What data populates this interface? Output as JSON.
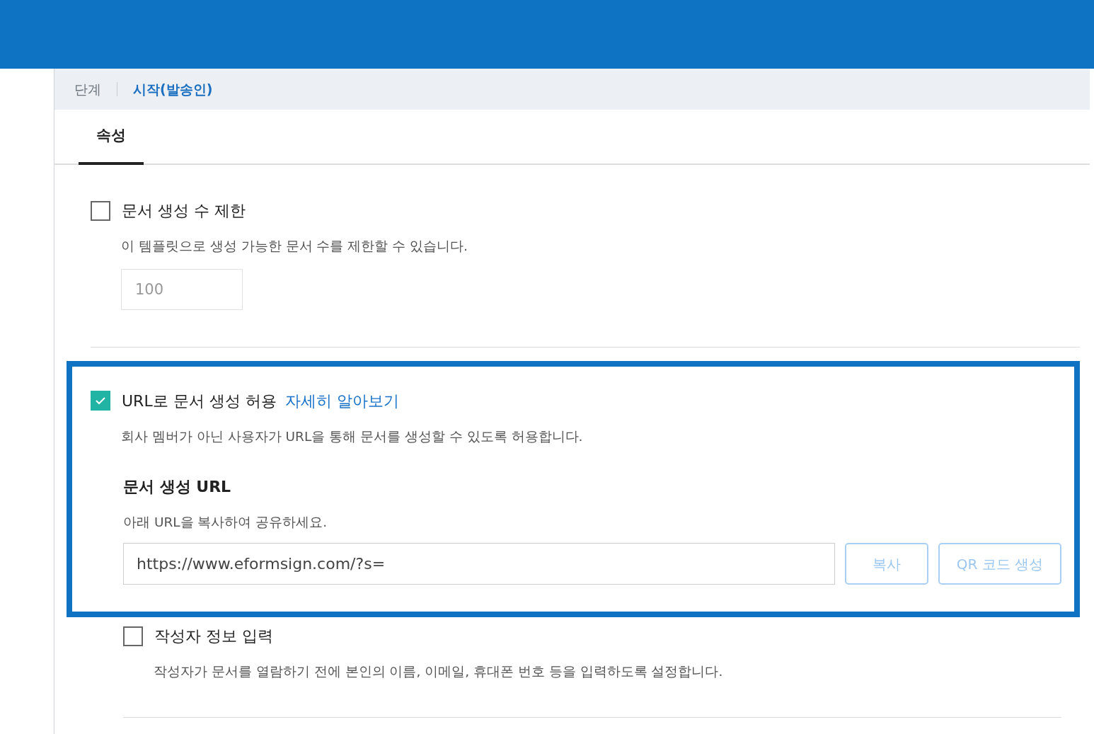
{
  "breadcrumb": {
    "label": "단계",
    "current": "시작(발송인)"
  },
  "tabs": [
    {
      "label": "속성",
      "selected": true
    }
  ],
  "settings": [
    {
      "label": "문서 생성 수 제한",
      "checked": false,
      "highlighted": false,
      "description": "이 템플릿으로 생성 가능한 문서 수를 제한할 수 있습니다.",
      "field": {
        "value": "100",
        "disabled": true
      }
    },
    {
      "label": "URL로 문서 생성 허용",
      "link": "자세히 알아보기",
      "checked": true,
      "highlighted": true,
      "description": "회사 멤버가 아닌 사용자가 URL을 통해 문서를 생성할 수 있도록 허용합니다.",
      "url_block": {
        "title": "문서 생성 URL",
        "hint": "아래 URL을 복사하여 공유하세요.",
        "value": "https://www.eformsign.com/?s=",
        "buttons": [
          {
            "label": "복사",
            "disabled": true
          },
          {
            "label": "QR 코드 생성",
            "disabled": true
          }
        ]
      },
      "children": [
        {
          "label": "작성자 정보 입력",
          "checked": false,
          "highlighted": false,
          "description": "작성자가 문서를 열람하기 전에 본인의 이름, 이메일, 휴대폰 번호 등을 입력하도록 설정합니다."
        }
      ]
    }
  ]
}
